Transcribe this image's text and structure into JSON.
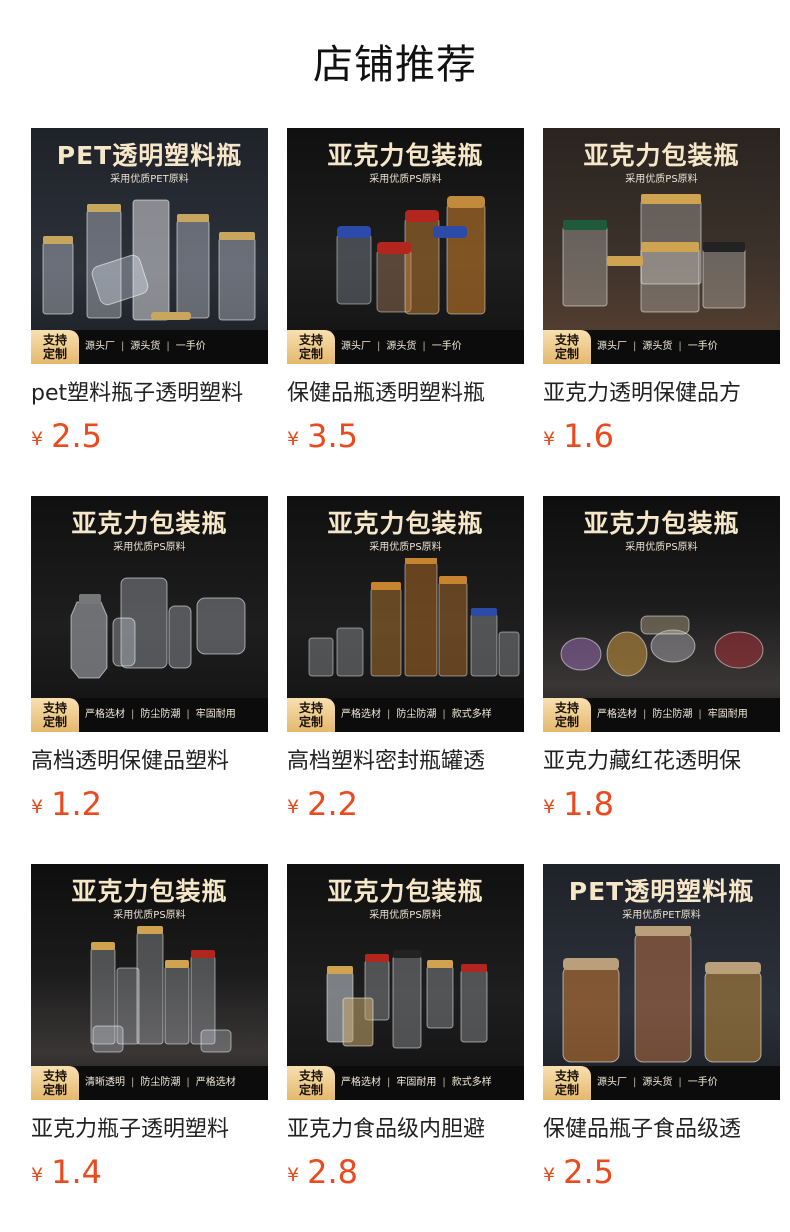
{
  "page": {
    "title": "店铺推荐"
  },
  "currency_symbol": "¥",
  "badge": {
    "line1": "支持",
    "line2": "定制"
  },
  "products": [
    {
      "banner_title": "PET透明塑料瓶",
      "banner_sub": "采用优质PET原料",
      "features": [
        "源头厂",
        "源头货",
        "一手价"
      ],
      "title": "pet塑料瓶子透明塑料",
      "price": "2.5",
      "theme": "bg-slate"
    },
    {
      "banner_title": "亚克力包装瓶",
      "banner_sub": "采用优质PS原料",
      "features": [
        "源头厂",
        "源头货",
        "一手价"
      ],
      "title": "保健品瓶透明塑料瓶",
      "price": "3.5",
      "theme": "bg-dark"
    },
    {
      "banner_title": "亚克力包装瓶",
      "banner_sub": "采用优质PS原料",
      "features": [
        "源头厂",
        "源头货",
        "一手价"
      ],
      "title": "亚克力透明保健品方",
      "price": "1.6",
      "theme": "bg-wood"
    },
    {
      "banner_title": "亚克力包装瓶",
      "banner_sub": "采用优质PS原料",
      "features": [
        "严格选材",
        "防尘防潮",
        "牢固耐用"
      ],
      "title": "高档透明保健品塑料",
      "price": "1.2",
      "theme": "bg-dark"
    },
    {
      "banner_title": "亚克力包装瓶",
      "banner_sub": "采用优质PS原料",
      "features": [
        "严格选材",
        "防尘防潮",
        "款式多样"
      ],
      "title": "高档塑料密封瓶罐透",
      "price": "2.2",
      "theme": "bg-dark"
    },
    {
      "banner_title": "亚克力包装瓶",
      "banner_sub": "采用优质PS原料",
      "features": [
        "严格选材",
        "防尘防潮",
        "牢固耐用"
      ],
      "title": "亚克力藏红花透明保",
      "price": "1.8",
      "theme": "bg-cloth"
    },
    {
      "banner_title": "亚克力包装瓶",
      "banner_sub": "采用优质PS原料",
      "features": [
        "清晰透明",
        "防尘防潮",
        "严格选材"
      ],
      "title": "亚克力瓶子透明塑料",
      "price": "1.4",
      "theme": "bg-cloth"
    },
    {
      "banner_title": "亚克力包装瓶",
      "banner_sub": "采用优质PS原料",
      "features": [
        "严格选材",
        "牢固耐用",
        "款式多样"
      ],
      "title": "亚克力食品级内胆避",
      "price": "2.8",
      "theme": "bg-dark"
    },
    {
      "banner_title": "PET透明塑料瓶",
      "banner_sub": "采用优质PET原料",
      "features": [
        "源头厂",
        "源头货",
        "一手价"
      ],
      "title": "保健品瓶子食品级透",
      "price": "2.5",
      "theme": "bg-slate"
    }
  ],
  "colors": {
    "price": "#ea4a1e",
    "banner_gold": "#f6e7c9",
    "badge_gold": "#e4b86e"
  }
}
